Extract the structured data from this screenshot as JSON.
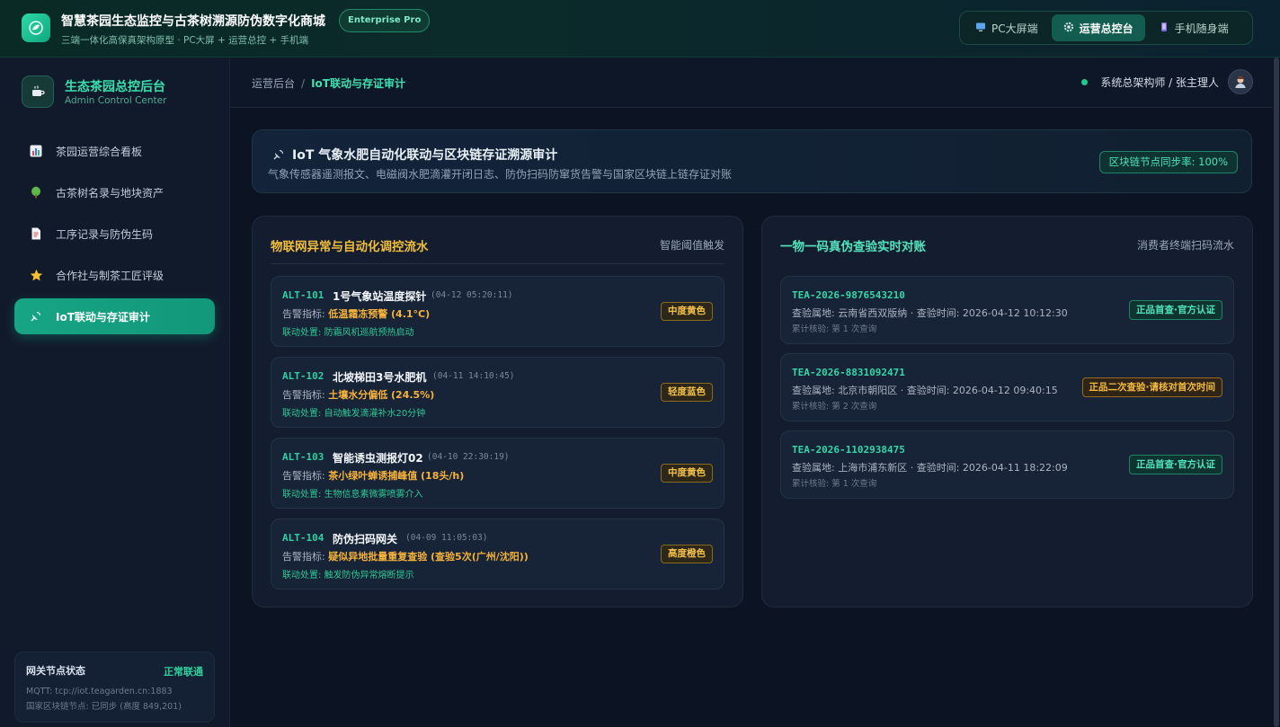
{
  "app": {
    "title": "智慧茶园生态监控与古茶树溯源防伪数字化商城",
    "edition_badge": "Enterprise Pro",
    "subtitle": "三端一体化高保真架构原型 · PC大屏 + 运营总控 + 手机端",
    "modes": [
      {
        "label": "PC大屏端",
        "icon": "monitor-icon",
        "active": false
      },
      {
        "label": "运营总控台",
        "icon": "gear-icon",
        "active": true
      },
      {
        "label": "手机随身端",
        "icon": "phone-icon",
        "active": false
      }
    ]
  },
  "sidebar": {
    "title": "生态茶园总控后台",
    "subtitle": "Admin Control Center",
    "items": [
      {
        "label": "茶园运营综合看板",
        "icon": "bar-chart-icon",
        "active": false
      },
      {
        "label": "古茶树名录与地块资产",
        "icon": "tree-icon",
        "active": false
      },
      {
        "label": "工序记录与防伪生码",
        "icon": "document-icon",
        "active": false
      },
      {
        "label": "合作社与制茶工匠评级",
        "icon": "star-icon",
        "active": false
      },
      {
        "label": "IoT联动与存证审计",
        "icon": "satellite-icon",
        "active": true
      }
    ],
    "gateway": {
      "title": "网关节点状态",
      "status": "正常联通",
      "mqtt": "MQTT: tcp://iot.teagarden.cn:1883",
      "chain": "国家区块链节点: 已同步 (高度 849,201)"
    }
  },
  "header": {
    "breadcrumb_root": "运营后台",
    "breadcrumb_sep": "/",
    "breadcrumb_current": "IoT联动与存证审计",
    "user": "系统总架构师 / 张主理人"
  },
  "banner": {
    "title": "IoT 气象水肥自动化联动与区块链存证溯源审计",
    "description": "气象传感器遥测报文、电磁阀水肥滴灌开闭日志、防伪扫码防窜货告警与国家区块链上链存证对账",
    "badge": "区块链节点同步率: 100%"
  },
  "alerts_panel": {
    "title": "物联网异常与自动化调控流水",
    "tag": "智能阈值触发",
    "metric_label": "告警指标: ",
    "action_label": "联动处置: ",
    "items": [
      {
        "id": "ALT-101",
        "device": "1号气象站温度探针",
        "time": "(04-12 05:20:11)",
        "metric": "低温霜冻预警 (4.1°C)",
        "action": "防霜风机巡航预热启动",
        "level": "中度黄色"
      },
      {
        "id": "ALT-102",
        "device": "北坡梯田3号水肥机",
        "time": "(04-11 14:10:45)",
        "metric": "土壤水分偏低 (24.5%)",
        "action": "自动触发滴灌补水20分钟",
        "level": "轻度蓝色"
      },
      {
        "id": "ALT-103",
        "device": "智能诱虫测报灯02",
        "time": "(04-10 22:30:19)",
        "metric": "茶小绿叶蝉诱捕峰值 (18头/h)",
        "action": "生物信息素微雾喷雾介入",
        "level": "中度黄色"
      },
      {
        "id": "ALT-104",
        "device": "防伪扫码网关",
        "time": "(04-09 11:05:03)",
        "metric": "疑似异地批量重复查验 (查验5次(广州/沈阳))",
        "action": "触发防伪异常熔断提示",
        "level": "高度橙色"
      }
    ]
  },
  "verify_panel": {
    "title": "一物一码真伪查验实时对账",
    "tag": "消费者终端扫码流水",
    "items": [
      {
        "code": "TEA-2026-9876543210",
        "info": "查验属地: 云南省西双版纳 · 查验时间: 2026-04-12 10:12:30",
        "count": "累计核验: 第 1 次查询",
        "status": "正品首查·官方认证",
        "warn": false
      },
      {
        "code": "TEA-2026-8831092471",
        "info": "查验属地: 北京市朝阳区 · 查验时间: 2026-04-12 09:40:15",
        "count": "累计核验: 第 2 次查询",
        "status": "正品二次查验·请核对首次时间",
        "warn": true
      },
      {
        "code": "TEA-2026-1102938475",
        "info": "查验属地: 上海市浦东新区 · 查验时间: 2026-04-11 18:22:09",
        "count": "累计核验: 第 1 次查询",
        "status": "正品首查·官方认证",
        "warn": false
      }
    ]
  },
  "colors": {
    "accent": "#17a585",
    "warning": "#f6b23a",
    "ok": "#4fe3b7"
  }
}
